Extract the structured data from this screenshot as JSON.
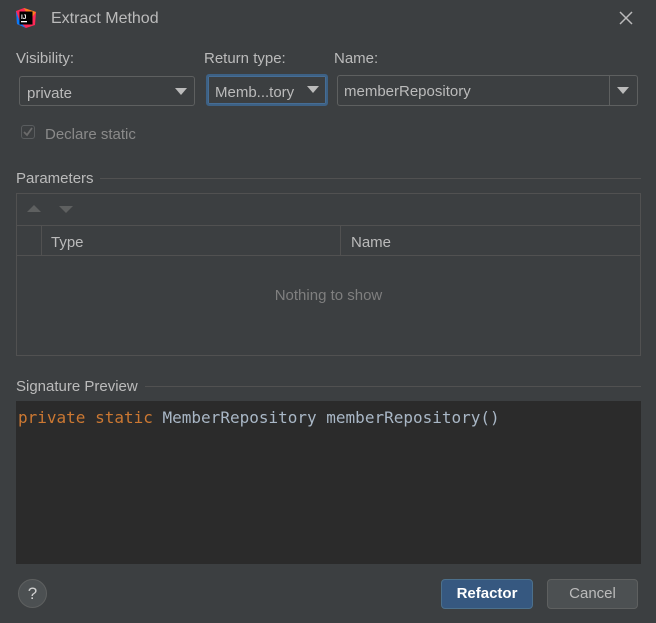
{
  "window": {
    "title": "Extract Method"
  },
  "labels": {
    "visibility": "Visibility:",
    "return_type": "Return type:",
    "name": "Name:"
  },
  "fields": {
    "visibility": "private",
    "return_type": "Memb...tory",
    "name": "memberRepository"
  },
  "declare_static": {
    "label": "Declare static",
    "checked": true,
    "enabled": false
  },
  "parameters": {
    "title": "Parameters",
    "columns": [
      "Type",
      "Name"
    ],
    "empty_text": "Nothing to show"
  },
  "signature": {
    "title": "Signature Preview",
    "tokens": [
      "private",
      "static",
      "MemberRepository",
      "memberRepository()"
    ]
  },
  "buttons": {
    "refactor": "Refactor",
    "cancel": "Cancel",
    "help": "?"
  },
  "colors": {
    "background": "#3c3f41",
    "editor_background": "#2b2b2b",
    "keyword": "#cc7832",
    "code_text": "#a9b7c6",
    "primary_button": "#365880",
    "focus_border": "#3d6185"
  }
}
